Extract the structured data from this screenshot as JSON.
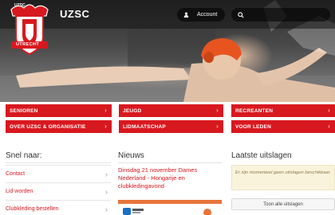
{
  "header": {
    "logo_text_top": "UZSC",
    "logo_text_bottom": "UTRECHT",
    "brand": "UZSC",
    "account_label": "Account"
  },
  "nav": {
    "items": [
      {
        "label": "SENIOREN"
      },
      {
        "label": "JEUGD"
      },
      {
        "label": "RECREANTEN"
      },
      {
        "label": "OVER UZSC & ORGANISATIE"
      },
      {
        "label": "LIDMAATSCHAP"
      },
      {
        "label": "VOOR LEDEN"
      }
    ]
  },
  "snel": {
    "title": "Snel naar:",
    "items": [
      {
        "label": "Contact"
      },
      {
        "label": "Lid worden"
      },
      {
        "label": "Clubkleding bestellen"
      }
    ]
  },
  "nieuws": {
    "title": "Nieuws",
    "headline": "Dinsdag 21 november Dames Nederland - Hongarije en clubkledingavond"
  },
  "uitslagen": {
    "title": "Laatste uitslagen",
    "empty_text": "Er zijn momenteel geen uitslagen beschikbaar.",
    "button_label": "Toon alle uitslagen"
  },
  "colors": {
    "brand_red": "#d8181f",
    "accent_orange": "#e8743b",
    "notice_bg": "#faf3dc"
  }
}
